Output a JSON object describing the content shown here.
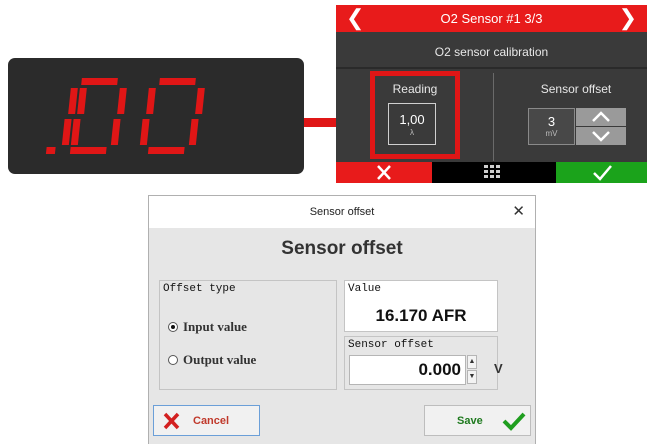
{
  "display": {
    "reading": "1.00"
  },
  "device": {
    "title": "O2 Sensor #1 3/3",
    "subtitle": "O2 sensor calibration",
    "reading": {
      "label": "Reading",
      "value": "1,00",
      "unit": "λ"
    },
    "offset": {
      "label": "Sensor offset",
      "value": "3",
      "unit": "mV"
    },
    "icons": {
      "prev": "chevron-left-icon",
      "next": "chevron-right-icon",
      "cancel": "close-icon",
      "menu": "grid-icon",
      "confirm": "checkmark-icon"
    }
  },
  "dialog": {
    "title": "Sensor offset",
    "heading": "Sensor offset",
    "offset_type": {
      "legend": "Offset type",
      "options": [
        "Input value",
        "Output value"
      ],
      "selected": "Input value"
    },
    "value": {
      "label": "Value",
      "text": "16.170 AFR"
    },
    "sensor_offset": {
      "legend": "Sensor offset",
      "value": "0.000",
      "unit": "V"
    },
    "cancel_label": "Cancel",
    "save_label": "Save"
  },
  "colors": {
    "accent_red": "#e81b1b",
    "accent_green": "#1ba31b",
    "display_bg": "#2b2b2b",
    "segment": "#e01616"
  }
}
